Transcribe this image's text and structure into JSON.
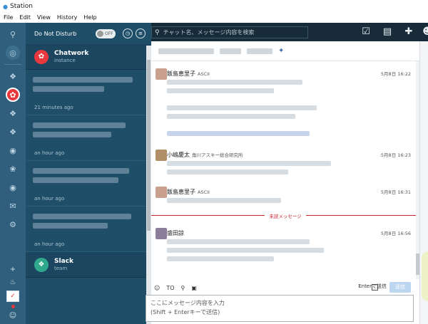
{
  "window": {
    "title": "Station"
  },
  "menu": [
    "File",
    "Edit",
    "View",
    "History",
    "Help"
  ],
  "panel": {
    "dnd_label": "Do Not Disturb",
    "toggle_label": "OFF",
    "apps": [
      {
        "name": "Chatwork",
        "sub": "instance"
      },
      {
        "name": "Slack",
        "sub": "team"
      }
    ],
    "notifications": [
      {
        "time": "21 minutes ago"
      },
      {
        "time": "an hour ago"
      },
      {
        "time": "an hour ago"
      },
      {
        "time": "an hour ago"
      }
    ]
  },
  "search": {
    "placeholder": "チャット名、メッセージ内容を検索"
  },
  "messages": [
    {
      "sender": "飯島恵里子",
      "org": "ASCII",
      "time": "5月8日 16:22"
    },
    {
      "sender": "小嶋慶太",
      "org": "角川アスキー総合研究所",
      "time": "5月8日 16:23"
    },
    {
      "sender": "飯島恵里子",
      "org": "ASCII",
      "time": "5月8日 16:31"
    },
    {
      "sender": "盛田諒",
      "org": "",
      "time": "5月8日 16:56"
    }
  ],
  "unread_label": "未読メッセージ",
  "composer": {
    "to_label": "TO",
    "enter_label": "Enterで送信",
    "send_label": "送信",
    "placeholder_line1": "ここにメッセージ内容を入力",
    "placeholder_line2": "(Shift + Enterキーで送信)"
  }
}
